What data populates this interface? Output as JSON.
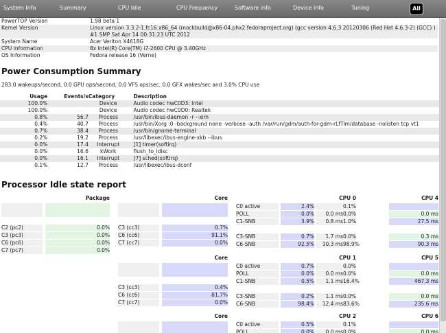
{
  "tabs": [
    "System Info",
    "Summary",
    "CPU Idle",
    "CPU Frequency",
    "Software info",
    "Device Info",
    "Tuning",
    "All"
  ],
  "sysinfo": [
    {
      "k": "PowerTOP Version",
      "v": "1.98 beta 1"
    },
    {
      "k": "Kernel Version",
      "v": "Linux version 3.3.2-1.fc16.x86_64 (mockbuild@x86-04.phx2.fedoraproject.org) (gcc version 4.6.3 20120306 (Red Hat 4.6.3-2) (GCC) ) #1 SMP Sat Apr 14 00:31:23 UTC 2012"
    },
    {
      "k": "System Name",
      "v": "Acer Veriton X4618G"
    },
    {
      "k": "CPU Information",
      "v": "8x Intel(R) Core(TM) i7-2600 CPU @ 3.40GHz"
    },
    {
      "k": "OS Information",
      "v": "Fedora release 16 (Verne)"
    }
  ],
  "power_title": "Power Consumption Summary",
  "power_summary": "283.0 wakeups/second, 0.0 GPU ops/second, 0.0 VFS ops/sec, 0.0 GFX wakes/sec and 3.0% CPU use",
  "power_headers": [
    "Usage",
    "Events/s",
    "Category",
    "Description"
  ],
  "power_rows": [
    [
      "100.0%",
      "",
      "Device",
      "Audio codec hwC0D3: Intel"
    ],
    [
      "100.0%",
      "",
      "Device",
      "Audio codec hwC0D0: Realtek"
    ],
    [
      "0.8%",
      "56.7",
      "Process",
      "/usr/bin/ibus-daemon -r --xim"
    ],
    [
      "0.4%",
      "40.7",
      "Process",
      "/usr/bin/Xorg :0 -background none -verbose -auth /var/run/gdm/auth-for-gdm-rLfTlm/database -nolisten tcp vt1"
    ],
    [
      "0.7%",
      "38.4",
      "Process",
      "/usr/bin/gnome-terminal"
    ],
    [
      "0.2%",
      "19.2",
      "Process",
      "/usr/libexec/ibus-engine-xkb --ibus"
    ],
    [
      "0.0%",
      "17.4",
      "Interrupt",
      "[1] timer(softirq)"
    ],
    [
      "0.0%",
      "16.6",
      "kWork",
      "flush_to_ldisc"
    ],
    [
      "0.0%",
      "16.1",
      "Interrupt",
      "[7] sched(softirq)"
    ],
    [
      "0.1%",
      "12.7",
      "Process",
      "/usr/libexec/ibus-dconf"
    ]
  ],
  "idle_title": "Processor Idle state report",
  "idle": {
    "package_label": "Package",
    "pkg_states": [
      [
        "C2 (pc2)",
        "0.0%"
      ],
      [
        "C3 (pc3)",
        "0.0%"
      ],
      [
        "C6 (pc6)",
        "0.0%"
      ],
      [
        "C7 (pc7)",
        "0.0%"
      ]
    ],
    "cores": [
      {
        "label": "Core",
        "states": [
          [
            "C3 (cc3)",
            "0.7%"
          ],
          [
            "C6 (cc6)",
            "91.1%"
          ],
          [
            "C7 (cc7)",
            "0.0%"
          ]
        ],
        "cpus": [
          {
            "label": "CPU 0",
            "rows": [
              [
                "C0 active",
                "2.4%",
                "",
                "0.1%"
              ],
              [
                "POLL",
                "0.0%",
                "0.0 ms",
                "0.0%"
              ],
              [
                "C1-SNB",
                "3.9%",
                "0.8 ms",
                "1.0%"
              ],
              [
                "C3-SNB",
                "0.7%",
                "1.7 ms",
                "0.0%"
              ],
              [
                "C6-SNB",
                "92.5%",
                "10.3 ms",
                "98.9%"
              ]
            ]
          },
          {
            "label": "CPU 4",
            "rows": [
              [
                "",
                "",
                "",
                ""
              ],
              [
                "",
                "",
                "0.0 ms",
                ""
              ],
              [
                "",
                "",
                "27.5 ms",
                ""
              ],
              [
                "",
                "",
                "0.3 ms",
                ""
              ],
              [
                "",
                "",
                "90.3 ms",
                ""
              ]
            ]
          }
        ]
      },
      {
        "label": "Core",
        "states": [
          [
            "C3 (cc3)",
            "0.4%"
          ],
          [
            "C6 (cc6)",
            "81.7%"
          ],
          [
            "C7 (cc7)",
            "0.0%"
          ]
        ],
        "cpus": [
          {
            "label": "CPU 1",
            "rows": [
              [
                "C0 active",
                "0.7%",
                "",
                "0.0%"
              ],
              [
                "POLL",
                "0.0%",
                "0.0 ms",
                "0.0%"
              ],
              [
                "C1-SNB",
                "0.5%",
                "1.1 ms",
                "16.4%"
              ],
              [
                "C3-SNB",
                "0.2%",
                "1.1 ms",
                "0.0%"
              ],
              [
                "C6-SNB",
                "98.4%",
                "12.4 ms",
                "83.6%"
              ]
            ]
          },
          {
            "label": "CPU 5",
            "rows": [
              [
                "",
                "",
                "",
                ""
              ],
              [
                "",
                "",
                "0.0 ms",
                ""
              ],
              [
                "",
                "",
                "467.3 ms",
                ""
              ],
              [
                "",
                "",
                "0.0 ms",
                ""
              ],
              [
                "",
                "",
                "235.6 ms",
                ""
              ]
            ]
          }
        ]
      },
      {
        "label": "Core",
        "states": [],
        "cpus": [
          {
            "label": "CPU 2",
            "rows": [
              [
                "C0 active",
                "0.5%",
                "",
                "0.1%"
              ],
              [
                "POLL",
                "0.0%",
                "0.0 ms",
                "0.0%"
              ]
            ]
          },
          {
            "label": "CPU 6",
            "rows": [
              [
                "",
                "",
                "",
                ""
              ],
              [
                "",
                "",
                "0.0 ms",
                ""
              ]
            ]
          }
        ]
      }
    ]
  }
}
